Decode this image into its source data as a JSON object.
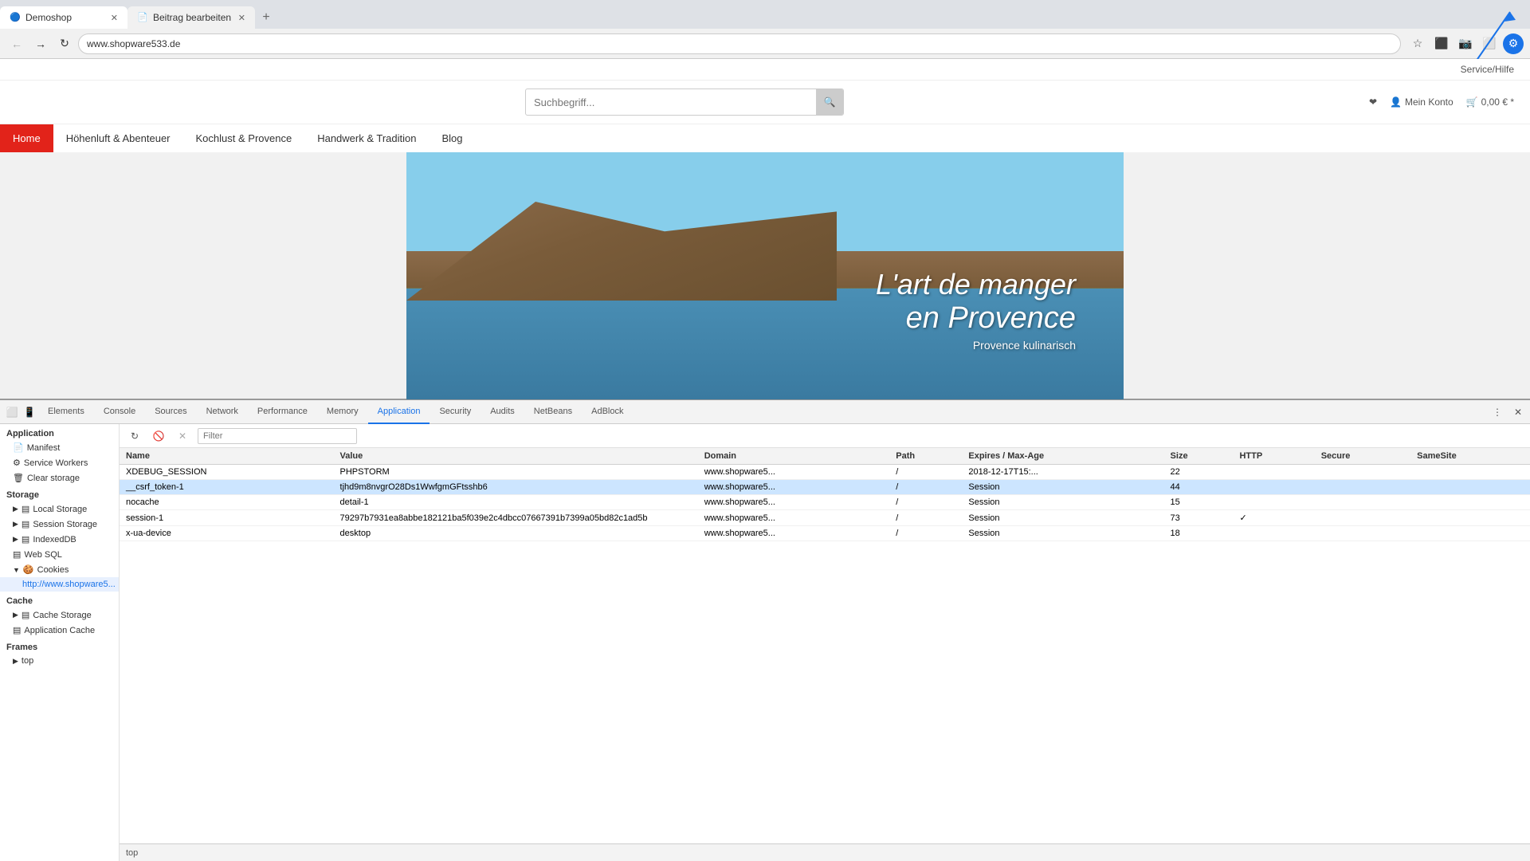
{
  "tabs": [
    {
      "id": "demoshop",
      "label": "Demoshop",
      "favicon": "🔵",
      "active": true
    },
    {
      "id": "beitrag",
      "label": "Beitrag bearbeiten",
      "favicon": "📄",
      "active": false
    }
  ],
  "addressBar": {
    "url": "www.shopware533.de"
  },
  "website": {
    "topbar": {
      "helpLabel": "Service/Hilfe"
    },
    "searchPlaceholder": "Suchbegriff...",
    "nav": [
      {
        "label": "Home",
        "active": true
      },
      {
        "label": "Höhenluft & Abenteuer",
        "active": false
      },
      {
        "label": "Kochlust & Provence",
        "active": false
      },
      {
        "label": "Handwerk & Tradition",
        "active": false
      },
      {
        "label": "Blog",
        "active": false
      }
    ],
    "hero": {
      "line1": "L'art de manger",
      "line2": "en Provence",
      "subtitle": "Provence kulinarisch"
    },
    "cart": "0,00 € *",
    "account": "Mein Konto"
  },
  "devtools": {
    "tabs": [
      {
        "label": "Elements"
      },
      {
        "label": "Console"
      },
      {
        "label": "Sources"
      },
      {
        "label": "Network"
      },
      {
        "label": "Performance"
      },
      {
        "label": "Memory"
      },
      {
        "label": "Application",
        "active": true
      },
      {
        "label": "Security"
      },
      {
        "label": "Audits"
      },
      {
        "label": "NetBeans"
      },
      {
        "label": "AdBlock"
      }
    ],
    "sidebar": {
      "sections": [
        {
          "label": "Application",
          "items": [
            {
              "label": "Manifest",
              "icon": "📄"
            },
            {
              "label": "Service Workers",
              "icon": "⚙"
            },
            {
              "label": "Clear storage",
              "icon": "🗑"
            }
          ]
        },
        {
          "label": "Storage",
          "items": [
            {
              "label": "Local Storage",
              "icon": "▤",
              "expandable": true
            },
            {
              "label": "Session Storage",
              "icon": "▤",
              "expandable": true
            },
            {
              "label": "IndexedDB",
              "icon": "▤"
            },
            {
              "label": "Web SQL",
              "icon": "▤"
            },
            {
              "label": "Cookies",
              "icon": "🍪",
              "expandable": true,
              "expanded": true
            },
            {
              "label": "http://www.shopware5...",
              "icon": "",
              "child": true,
              "selected": true
            }
          ]
        },
        {
          "label": "Cache",
          "items": [
            {
              "label": "Cache Storage",
              "icon": "▤",
              "expandable": true
            },
            {
              "label": "Application Cache",
              "icon": "▤"
            }
          ]
        },
        {
          "label": "Frames",
          "items": [
            {
              "label": "top",
              "icon": "▶",
              "expandable": true
            }
          ]
        }
      ]
    },
    "panel": {
      "title": "Application",
      "filterPlaceholder": "Filter"
    },
    "cookies": {
      "columns": [
        "Name",
        "Value",
        "Domain",
        "Path",
        "Expires / Max-Age",
        "Size",
        "HTTP",
        "Secure",
        "SameSite"
      ],
      "rows": [
        {
          "name": "XDEBUG_SESSION",
          "value": "PHPSTORM",
          "domain": "www.shopware5...",
          "path": "/",
          "expires": "2018-12-17T15:...",
          "size": "22",
          "http": "",
          "secure": "",
          "sameSite": "",
          "selected": false
        },
        {
          "name": "__csrf_token-1",
          "value": "tjhd9m8nvgrO28Ds1WwfgmGFtsshb6",
          "domain": "www.shopware5...",
          "path": "/",
          "expires": "Session",
          "size": "44",
          "http": "",
          "secure": "",
          "sameSite": "",
          "selected": true
        },
        {
          "name": "nocache",
          "value": "detail-1",
          "domain": "www.shopware5...",
          "path": "/",
          "expires": "Session",
          "size": "15",
          "http": "",
          "secure": "",
          "sameSite": "",
          "selected": false
        },
        {
          "name": "session-1",
          "value": "79297b7931ea8abbe182121ba5f039e2c4dbcc07667391b7399a05bd82c1ad5b",
          "domain": "www.shopware5...",
          "path": "/",
          "expires": "Session",
          "size": "73",
          "http": "✓",
          "secure": "",
          "sameSite": "",
          "selected": false
        },
        {
          "name": "x-ua-device",
          "value": "desktop",
          "domain": "www.shopware5...",
          "path": "/",
          "expires": "Session",
          "size": "18",
          "http": "",
          "secure": "",
          "sameSite": "",
          "selected": false
        }
      ]
    },
    "statusBar": {
      "text": "top"
    }
  }
}
